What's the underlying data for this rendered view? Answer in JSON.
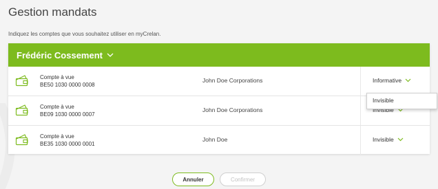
{
  "page": {
    "title": "Gestion mandats",
    "subtitle": "Indiquez les comptes que vous souhaitez utiliser en myCrelan."
  },
  "owner": {
    "name": "Frédéric Cossement"
  },
  "accounts": [
    {
      "type": "Compte à vue",
      "number": "BE50 1030 0000 0008",
      "holder": "John Doe Corporations",
      "visibility": "Informative"
    },
    {
      "type": "Compte à vue",
      "number": "BE09 1030 0000 0007",
      "holder": "John Doe Corporations",
      "visibility": "Invisible"
    },
    {
      "type": "Compte à vue",
      "number": "BE35 1030 0000 0001",
      "holder": "John Doe",
      "visibility": "Invisible"
    }
  ],
  "dropdown": {
    "options": [
      "Invisible"
    ]
  },
  "buttons": {
    "cancel": "Annuler",
    "confirm": "Confirmer"
  },
  "colors": {
    "accent": "#7dbb1e",
    "header_text": "#ffffff",
    "disabled_text": "#c2c2c2"
  },
  "icons": {
    "account": "wallet-icon",
    "chevron": "chevron-down-icon"
  }
}
